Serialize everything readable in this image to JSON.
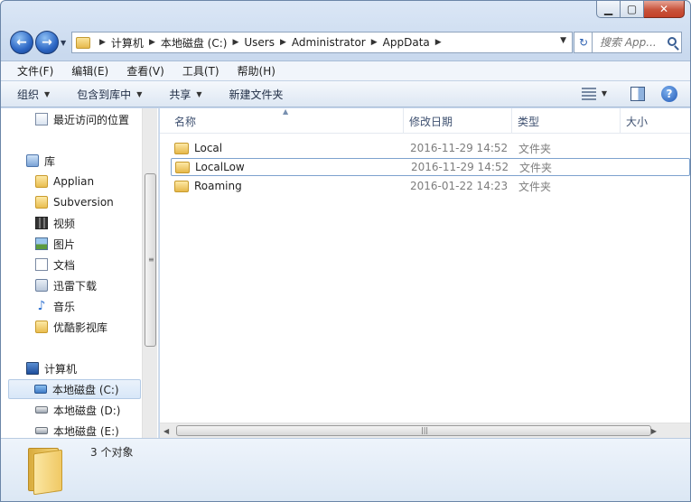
{
  "titlebar": {
    "minimize_glyph": "▁",
    "maximize_glyph": "▢",
    "close_glyph": "✕"
  },
  "navigation": {
    "back_glyph": "←",
    "forward_glyph": "→",
    "breadcrumb": [
      "计算机",
      "本地磁盘 (C:)",
      "Users",
      "Administrator",
      "AppData"
    ],
    "refresh_glyph": "↻",
    "search_placeholder": "搜索 App..."
  },
  "menu": [
    "文件(F)",
    "编辑(E)",
    "查看(V)",
    "工具(T)",
    "帮助(H)"
  ],
  "toolbar": {
    "organize": "组织",
    "include_in_library": "包含到库中",
    "share": "共享",
    "new_folder": "新建文件夹",
    "help_glyph": "?"
  },
  "sidebar": {
    "recent": "最近访问的位置",
    "libraries": "库",
    "library_items": [
      "Applian",
      "Subversion",
      "视频",
      "图片",
      "文档",
      "迅雷下载",
      "音乐",
      "优酷影视库"
    ],
    "computer": "计算机",
    "drives": [
      "本地磁盘 (C:)",
      "本地磁盘 (D:)",
      "本地磁盘 (E:)"
    ],
    "selected_drive": "本地磁盘 (C:)"
  },
  "columns": {
    "name": "名称",
    "date": "修改日期",
    "type": "类型",
    "size": "大小"
  },
  "files": [
    {
      "name": "Local",
      "modified": "2016-11-29 14:52",
      "type": "文件夹"
    },
    {
      "name": "LocalLow",
      "modified": "2016-11-29 14:52",
      "type": "文件夹"
    },
    {
      "name": "Roaming",
      "modified": "2016-01-22 14:23",
      "type": "文件夹"
    }
  ],
  "selected_file": "LocalLow",
  "status": {
    "item_count": "3 个对象"
  },
  "colors": {
    "accent": "#2c66c4",
    "selection_border": "#7da2ce",
    "folder": "#e9bd4f"
  }
}
